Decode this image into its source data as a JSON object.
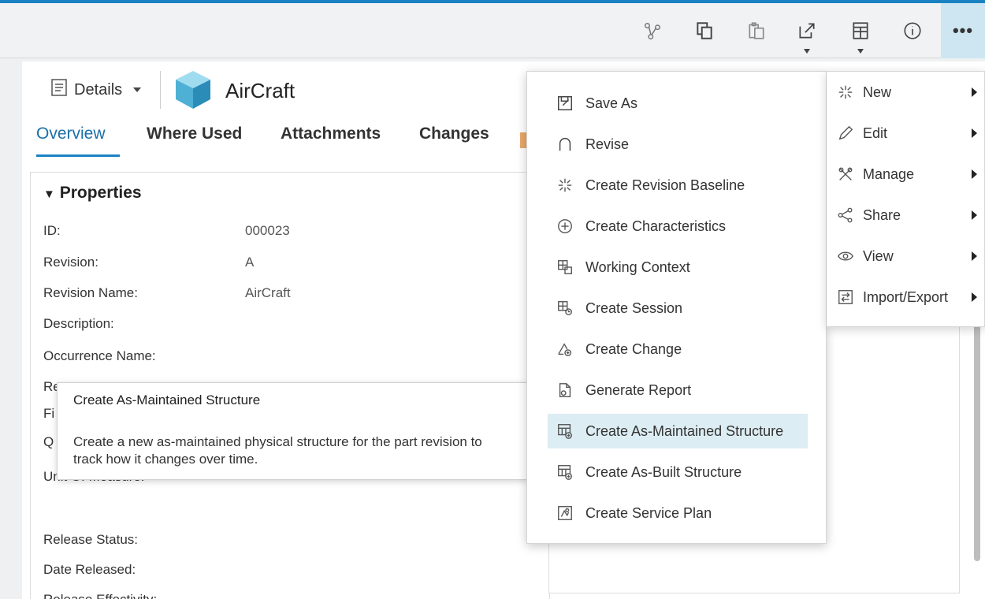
{
  "object": {
    "title": "AirCraft",
    "details_label": "Details"
  },
  "tabs": [
    {
      "label": "Overview"
    },
    {
      "label": "Where Used"
    },
    {
      "label": "Attachments"
    },
    {
      "label": "Changes"
    }
  ],
  "properties": {
    "title": "Properties",
    "rows": [
      {
        "label": "ID:",
        "value": "000023"
      },
      {
        "label": "Revision:",
        "value": "A"
      },
      {
        "label": "Revision Name:",
        "value": "AirCraft"
      },
      {
        "label": "Description:",
        "value": ""
      },
      {
        "label": "Occurrence Name:",
        "value": ""
      },
      {
        "label": "Re",
        "value": ""
      },
      {
        "label": "Fi",
        "value": ""
      },
      {
        "label": "Q",
        "value": ""
      },
      {
        "label": "Unit Of Measure:",
        "value": ""
      },
      {
        "label": "Release Status:",
        "value": ""
      },
      {
        "label": "Date Released:",
        "value": ""
      },
      {
        "label": "Release Effectivity:",
        "value": ""
      }
    ]
  },
  "tooltip": {
    "title": "Create As-Maintained Structure",
    "body": "Create a new as-maintained physical structure for the part revision to track how it changes over time."
  },
  "submenu": [
    {
      "label": "Save As",
      "icon": "save-as-icon"
    },
    {
      "label": "Revise",
      "icon": "revise-icon"
    },
    {
      "label": "Create Revision Baseline",
      "icon": "baseline-icon"
    },
    {
      "label": "Create Characteristics",
      "icon": "characteristics-icon"
    },
    {
      "label": "Working Context",
      "icon": "working-context-icon"
    },
    {
      "label": "Create Session",
      "icon": "session-icon"
    },
    {
      "label": "Create Change",
      "icon": "change-icon"
    },
    {
      "label": "Generate Report",
      "icon": "report-icon"
    },
    {
      "label": "Create As-Maintained Structure",
      "icon": "as-maintained-icon"
    },
    {
      "label": "Create As-Built Structure",
      "icon": "as-built-icon"
    },
    {
      "label": "Create Service Plan",
      "icon": "service-plan-icon"
    }
  ],
  "mainmenu": [
    {
      "label": "New",
      "icon": "new-icon"
    },
    {
      "label": "Edit",
      "icon": "edit-icon"
    },
    {
      "label": "Manage",
      "icon": "manage-icon"
    },
    {
      "label": "Share",
      "icon": "share-icon"
    },
    {
      "label": "View",
      "icon": "view-icon"
    },
    {
      "label": "Import/Export",
      "icon": "import-export-icon"
    }
  ],
  "toolbar": {
    "more_label": "•••",
    "icons": [
      "branch-icon",
      "copy-icon",
      "paste-icon",
      "open-in-icon",
      "layout-icon",
      "info-icon",
      "more-icon"
    ]
  },
  "colors": {
    "accent": "#1a82c3",
    "highlight": "#dcedf3",
    "toolbar_active": "#cde6f1"
  }
}
